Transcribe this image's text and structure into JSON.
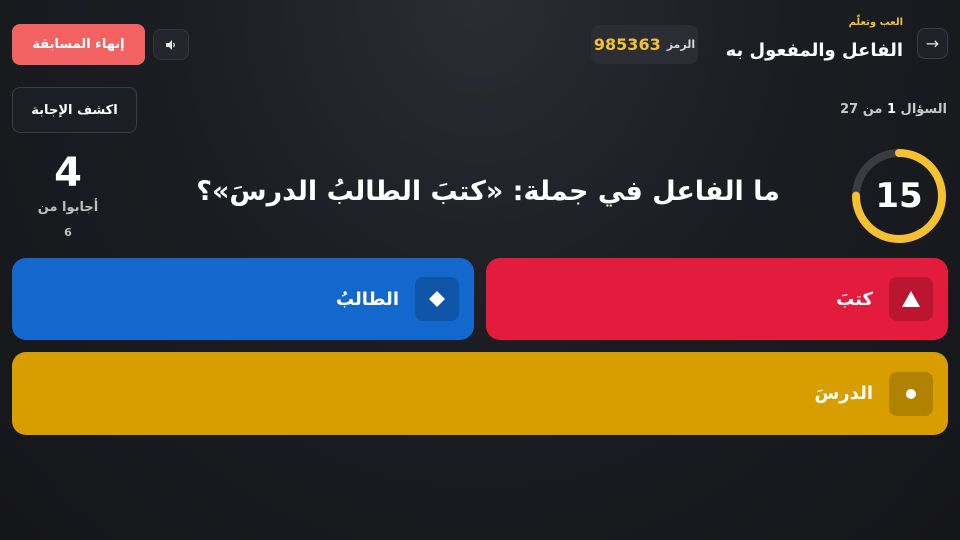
{
  "header": {
    "back_icon": "arrow-right-icon",
    "back_glyph": "→",
    "brand": "العب وتعلّم",
    "quiz_title": "الفاعل والمفعول به",
    "code_label": "الرمز",
    "code_value": "985363",
    "sound_icon": "speaker-icon",
    "end_label": "إنهاء المسابقة"
  },
  "progress": {
    "prefix": "السؤال",
    "current": "1",
    "separator": "من",
    "total": "27",
    "reveal_label": "اكشف الإجابة"
  },
  "timer": {
    "value": "15",
    "remaining_fraction": 0.75,
    "ring_color": "#f5c12e",
    "track_color": "#3a3c42"
  },
  "question": {
    "text": "ما الفاعل في جملة: «كتبَ الطالبُ الدرسَ»؟"
  },
  "answers_counter": {
    "count": "4",
    "label": "أجابوا من",
    "total": "6"
  },
  "answers": [
    {
      "text": "كتبَ",
      "shape": "triangle-icon",
      "color": "#e31c3d"
    },
    {
      "text": "الطالبُ",
      "shape": "diamond-icon",
      "color": "#1368ce"
    },
    {
      "text": "الدرسَ",
      "shape": "circle-icon",
      "color": "#d89e00"
    }
  ]
}
